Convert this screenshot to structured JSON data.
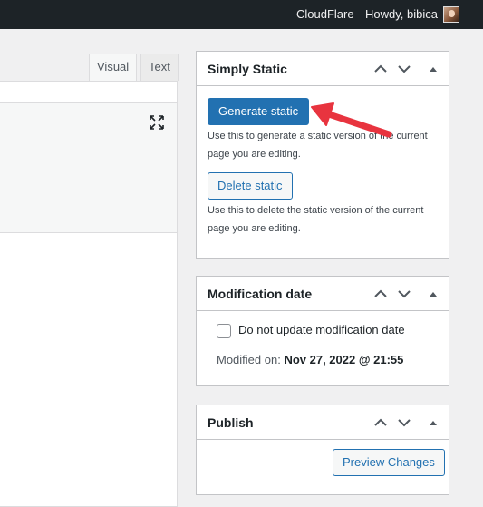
{
  "admin_bar": {
    "cloudflare": "CloudFlare",
    "howdy": "Howdy, bibica"
  },
  "editor": {
    "tabs": [
      "Visual",
      "Text"
    ],
    "active_tab": "Visual"
  },
  "simply_static": {
    "title": "Simply Static",
    "generate_label": "Generate static",
    "generate_help": "Use this to generate a static version of the current page you are editing.",
    "delete_label": "Delete static",
    "delete_help": "Use this to delete the static version of the current page you are editing."
  },
  "modification_date": {
    "title": "Modification date",
    "checkbox_label": "Do not update modification date",
    "checkbox_checked": false,
    "modified_prefix": "Modified on:",
    "modified_value": "Nov 27, 2022 @ 21:55"
  },
  "publish": {
    "title": "Publish",
    "preview_label": "Preview Changes"
  },
  "colors": {
    "admin_bar": "#1d2327",
    "primary": "#2271b1",
    "arrow": "#e8343f"
  },
  "icons": {
    "move_up": "chevron-up-icon",
    "move_down": "chevron-down-icon",
    "toggle": "triangle-up-icon",
    "fullscreen": "expand-icon",
    "annotation": "red-arrow-icon"
  }
}
